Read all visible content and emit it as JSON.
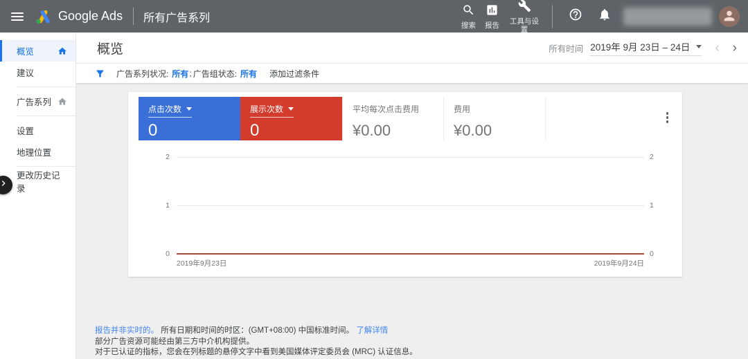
{
  "topbar": {
    "brand": "Google Ads",
    "section_title": "所有广告系列",
    "search_label": "搜索",
    "reports_label": "报告",
    "tools_label": "工具与设置"
  },
  "sidebar": {
    "items": [
      {
        "label": "概览",
        "selected": true
      },
      {
        "label": "建议"
      },
      {
        "label": "广告系列"
      },
      {
        "label": "设置"
      },
      {
        "label": "地理位置"
      },
      {
        "label": "更改历史记录"
      }
    ]
  },
  "header": {
    "title": "概览",
    "time_scope_label": "所有时间",
    "date_range": "2019年 9月 23日 – 24日"
  },
  "filter": {
    "campaign_status_label": "广告系列状况:",
    "campaign_status_value": "所有",
    "separator": ";",
    "adgroup_status_label": "广告组状态:",
    "adgroup_status_value": "所有",
    "add_filter_label": "添加过滤条件"
  },
  "metrics": [
    {
      "label": "点击次数",
      "value": "0",
      "color": "#3b6fd8",
      "selected": true
    },
    {
      "label": "展示次数",
      "value": "0",
      "color": "#d33b2c",
      "selected": true
    },
    {
      "label": "平均每次点击费用",
      "value": "¥0.00"
    },
    {
      "label": "费用",
      "value": "¥0.00"
    }
  ],
  "chart_data": {
    "type": "line",
    "x": [
      "2019年9月23日",
      "2019年9月24日"
    ],
    "series": [
      {
        "name": "点击次数",
        "color": "#3b6fd8",
        "values": [
          0,
          0
        ]
      },
      {
        "name": "展示次数",
        "color": "#a34a3a",
        "values": [
          0,
          0
        ]
      }
    ],
    "ylim": [
      0,
      2
    ],
    "yticks": [
      "0",
      "1",
      "2"
    ],
    "grid": true,
    "dual_axis": true,
    "legend_position": "none"
  },
  "icons": {
    "prev_chevron": "‹",
    "next_chevron": "›"
  },
  "footer": {
    "line1_link": "报告并非实时的。",
    "line1_text": "所有日期和时间的时区：(GMT+08:00) 中国标准时间。",
    "line1_link2": "了解详情",
    "line2": "部分广告资源可能经由第三方中介机构提供。",
    "line3": "对于已认证的指标，您会在列标题的悬停文字中看到美国媒体评定委员会 (MRC) 认证信息。"
  },
  "colors": {
    "topbar_bg": "#5f6368",
    "accent_blue": "#1a73e8",
    "link_blue": "#4285f4",
    "card_blue": "#3b6fd8",
    "card_red": "#d33b2c",
    "chart_line": "#a34a3a"
  }
}
